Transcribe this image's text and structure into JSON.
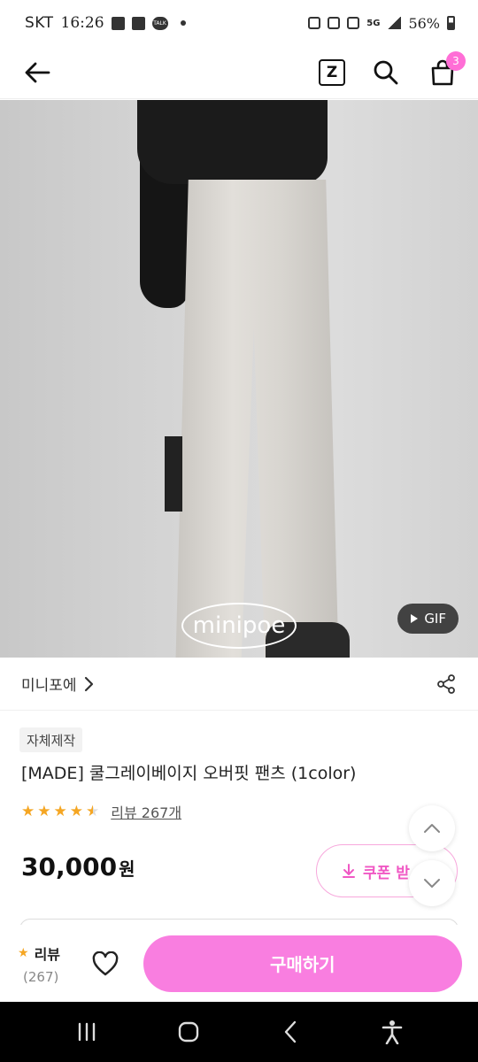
{
  "status_bar": {
    "carrier": "SKT",
    "time": "16:26",
    "battery": "56%",
    "network_badge": "5G",
    "talk_badge": "TALK"
  },
  "header": {
    "cart_count": "3",
    "icons": [
      "back-arrow-icon",
      "zigzag-z-icon",
      "search-icon",
      "shopping-bag-icon"
    ]
  },
  "product_image": {
    "watermark": "minipoe",
    "gif_label": "GIF"
  },
  "brand": {
    "name": "미니포에"
  },
  "product": {
    "tag": "자체제작",
    "title": "[MADE] 쿨그레이베이지 오버핏 팬츠 (1color)",
    "rating": 4.5,
    "review_link": "리뷰 267개",
    "price": "30,000",
    "currency": "원",
    "coupon_label": "쿠폰 받"
  },
  "purchase_bar": {
    "review_label": "리뷰",
    "review_count": "(267)",
    "buy_label": "구매하기"
  },
  "colors": {
    "accent_pink": "#f97ee0",
    "coupon_pink": "#f058c4",
    "star": "#f5a623",
    "badge": "#ff6ed6"
  }
}
